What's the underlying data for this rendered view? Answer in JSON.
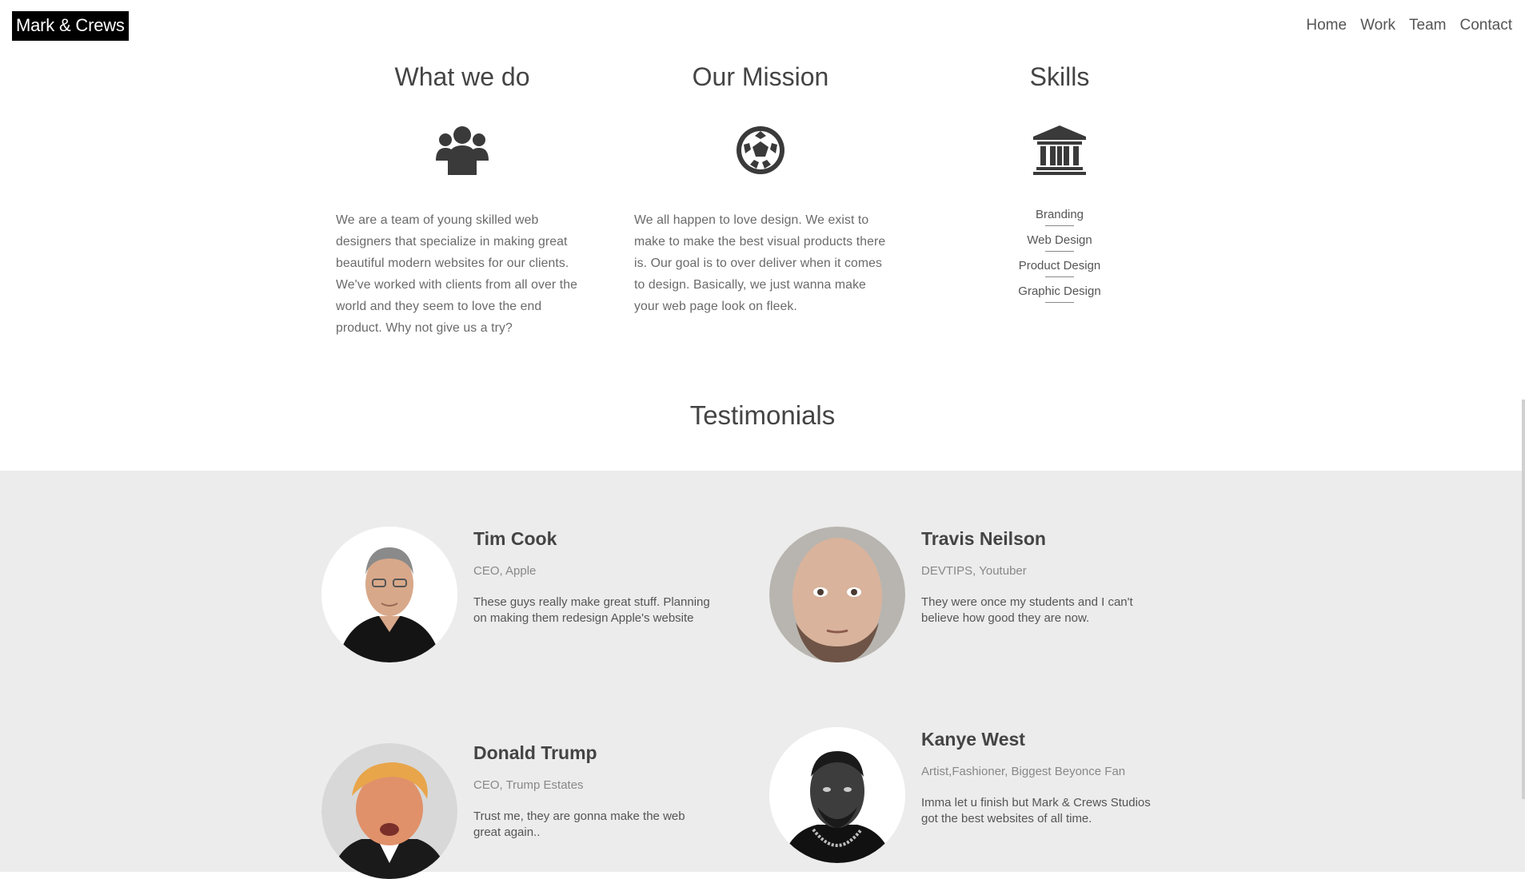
{
  "header": {
    "brand": "Mark & Crews",
    "nav": [
      "Home",
      "Work",
      "Team",
      "Contact"
    ]
  },
  "features": {
    "what_we_do": {
      "title": "What we do",
      "icon": "users-icon",
      "text": "We are a team of young skilled web designers that specialize in making great beautiful modern websites for our clients. We've worked with clients from all over the world and they seem to love the end product. Why not give us a try?"
    },
    "mission": {
      "title": "Our Mission",
      "icon": "soccer-ball-icon",
      "text": "We all happen to love design. We exist to make to make the best visual products there is. Our goal is to over deliver when it comes to design. Basically, we just wanna make your web page look on fleek."
    },
    "skills": {
      "title": "Skills",
      "icon": "bank-icon",
      "items": [
        "Branding",
        "Web Design",
        "Product Design",
        "Graphic Design"
      ]
    }
  },
  "testimonials": {
    "title": "Testimonials",
    "items": [
      {
        "name": "Tim Cook",
        "role": "CEO, Apple",
        "quote": "These guys really make great stuff. Planning on making them redesign Apple's website"
      },
      {
        "name": "Travis Neilson",
        "role": "DEVTIPS, Youtuber",
        "quote": "They were once my students and I can't believe how good they are now."
      },
      {
        "name": "Donald Trump",
        "role": "CEO, Trump Estates",
        "quote": "Trust me, they are gonna make the web great again.."
      },
      {
        "name": "Kanye West",
        "role": "Artist,Fashioner, Biggest Beyonce Fan",
        "quote": "Imma let u finish but Mark & Crews Studios got the best websites of all time."
      }
    ]
  }
}
